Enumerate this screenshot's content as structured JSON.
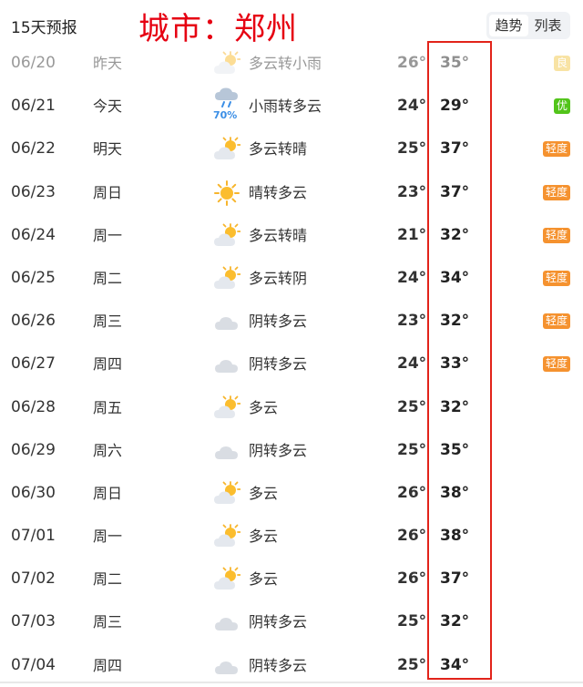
{
  "header": {
    "title": "15天预报",
    "city_label": "城市：郑州",
    "toggle": {
      "trend_label": "趋势",
      "list_label": "列表"
    }
  },
  "colors": {
    "aqi_good": "#f2c94c",
    "aqi_excellent": "#52c41a",
    "aqi_light": "#f5922f",
    "highlight_border": "#e2231a",
    "city_label": "#e60012"
  },
  "forecast": [
    {
      "date": "06/20",
      "day": "昨天",
      "icon": "partly-cloudy-icon",
      "desc": "多云转小雨",
      "low": "26°",
      "high": "35°",
      "aqi": "良",
      "aqi_level": "good",
      "past": true
    },
    {
      "date": "06/21",
      "day": "今天",
      "icon": "light-rain-icon",
      "precip": "70%",
      "desc": "小雨转多云",
      "low": "24°",
      "high": "29°",
      "aqi": "优",
      "aqi_level": "excellent"
    },
    {
      "date": "06/22",
      "day": "明天",
      "icon": "partly-cloudy-icon",
      "desc": "多云转晴",
      "low": "25°",
      "high": "37°",
      "aqi": "轻度",
      "aqi_level": "light"
    },
    {
      "date": "06/23",
      "day": "周日",
      "icon": "sunny-icon",
      "desc": "晴转多云",
      "low": "23°",
      "high": "37°",
      "aqi": "轻度",
      "aqi_level": "light"
    },
    {
      "date": "06/24",
      "day": "周一",
      "icon": "partly-cloudy-icon",
      "desc": "多云转晴",
      "low": "21°",
      "high": "32°",
      "aqi": "轻度",
      "aqi_level": "light"
    },
    {
      "date": "06/25",
      "day": "周二",
      "icon": "partly-cloudy-icon",
      "desc": "多云转阴",
      "low": "24°",
      "high": "34°",
      "aqi": "轻度",
      "aqi_level": "light"
    },
    {
      "date": "06/26",
      "day": "周三",
      "icon": "overcast-icon",
      "desc": "阴转多云",
      "low": "23°",
      "high": "32°",
      "aqi": "轻度",
      "aqi_level": "light"
    },
    {
      "date": "06/27",
      "day": "周四",
      "icon": "overcast-icon",
      "desc": "阴转多云",
      "low": "24°",
      "high": "33°",
      "aqi": "轻度",
      "aqi_level": "light"
    },
    {
      "date": "06/28",
      "day": "周五",
      "icon": "partly-cloudy-icon",
      "desc": "多云",
      "low": "25°",
      "high": "32°",
      "aqi": "",
      "aqi_level": ""
    },
    {
      "date": "06/29",
      "day": "周六",
      "icon": "overcast-icon",
      "desc": "阴转多云",
      "low": "25°",
      "high": "35°",
      "aqi": "",
      "aqi_level": ""
    },
    {
      "date": "06/30",
      "day": "周日",
      "icon": "partly-cloudy-icon",
      "desc": "多云",
      "low": "26°",
      "high": "38°",
      "aqi": "",
      "aqi_level": ""
    },
    {
      "date": "07/01",
      "day": "周一",
      "icon": "partly-cloudy-icon",
      "desc": "多云",
      "low": "26°",
      "high": "38°",
      "aqi": "",
      "aqi_level": ""
    },
    {
      "date": "07/02",
      "day": "周二",
      "icon": "partly-cloudy-icon",
      "desc": "多云",
      "low": "26°",
      "high": "37°",
      "aqi": "",
      "aqi_level": ""
    },
    {
      "date": "07/03",
      "day": "周三",
      "icon": "overcast-icon",
      "desc": "阴转多云",
      "low": "25°",
      "high": "32°",
      "aqi": "",
      "aqi_level": ""
    },
    {
      "date": "07/04",
      "day": "周四",
      "icon": "overcast-icon",
      "desc": "阴转多云",
      "low": "25°",
      "high": "34°",
      "aqi": "",
      "aqi_level": ""
    }
  ]
}
